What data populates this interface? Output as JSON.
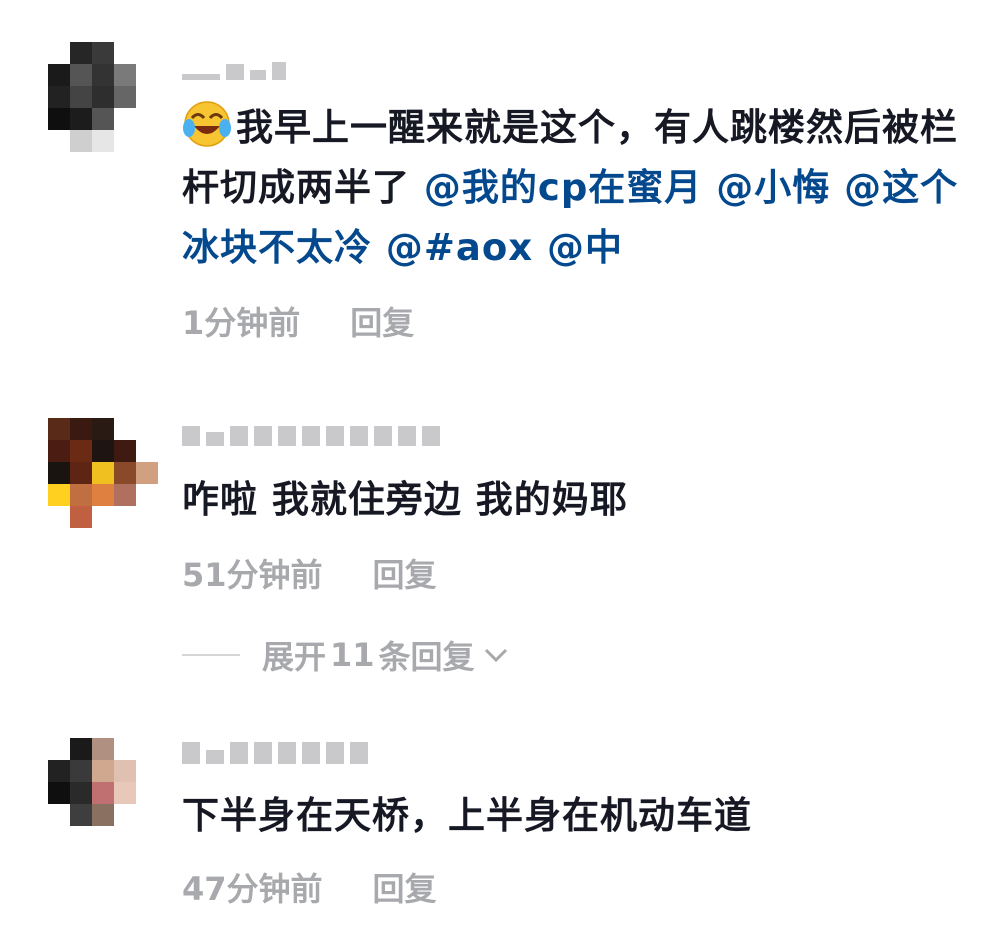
{
  "comments": [
    {
      "avatar_colors": [
        "#ffffff",
        "#262626",
        "#3a3a3a",
        "#ffffff",
        "#ffffff",
        "#1a1a1a",
        "#555555",
        "#333333",
        "#7a7a7a",
        "#ffffff",
        "#222222",
        "#444444",
        "#2e2e2e",
        "#666666",
        "#ffffff",
        "#0f0f0f",
        "#1c1c1c",
        "#555555",
        "#ffffff",
        "#ffffff",
        "#ffffff",
        "#cfcfcf",
        "#e6e6e6",
        "#ffffff",
        "#ffffff"
      ],
      "content": {
        "emoji": "laughing-crying-emoji",
        "text": "我早上一醒来就是这个，有人跳楼然后被栏杆切成两半了",
        "mentions": [
          "@我的cp在蜜月",
          "@小悔",
          "@这个冰块不太冷",
          "@#aox",
          "@中"
        ]
      },
      "time": "1分钟前",
      "reply_label": "回复"
    },
    {
      "avatar_colors": [
        "#5a2a18",
        "#3a1a10",
        "#2a1a14",
        "#ffffff",
        "#ffffff",
        "#4a1c12",
        "#6b2a14",
        "#1e1412",
        "#3e1a10",
        "#ffffff",
        "#1a1410",
        "#5e2414",
        "#f0c020",
        "#8a4a2a",
        "#d0a080",
        "#ffd020",
        "#c07040",
        "#e08040",
        "#b07060",
        "#ffffff",
        "#ffffff",
        "#c06040",
        "#ffffff",
        "#ffffff",
        "#ffffff"
      ],
      "content": {
        "text": "咋啦 我就住旁边 我的妈耶"
      },
      "time": "51分钟前",
      "reply_label": "回复",
      "expand": {
        "prefix": "展开",
        "count": "11",
        "suffix": "条回复"
      }
    },
    {
      "avatar_colors": [
        "#ffffff",
        "#1a1a1a",
        "#b09080",
        "#ffffff",
        "#ffffff",
        "#222222",
        "#3a3a3a",
        "#d0a890",
        "#e0c0b0",
        "#ffffff",
        "#0f0f0f",
        "#2a2a2a",
        "#c07070",
        "#e8c8b8",
        "#ffffff",
        "#ffffff",
        "#3e3e3e",
        "#8a7060",
        "#ffffff",
        "#ffffff",
        "#ffffff",
        "#ffffff",
        "#ffffff",
        "#ffffff",
        "#ffffff"
      ],
      "content": {
        "text": "下半身在天桥，上半身在机动车道"
      },
      "time": "47分钟前",
      "reply_label": "回复"
    }
  ],
  "colors": {
    "text": "#161823",
    "mention": "#04498d",
    "meta": "#a8a9ad"
  }
}
